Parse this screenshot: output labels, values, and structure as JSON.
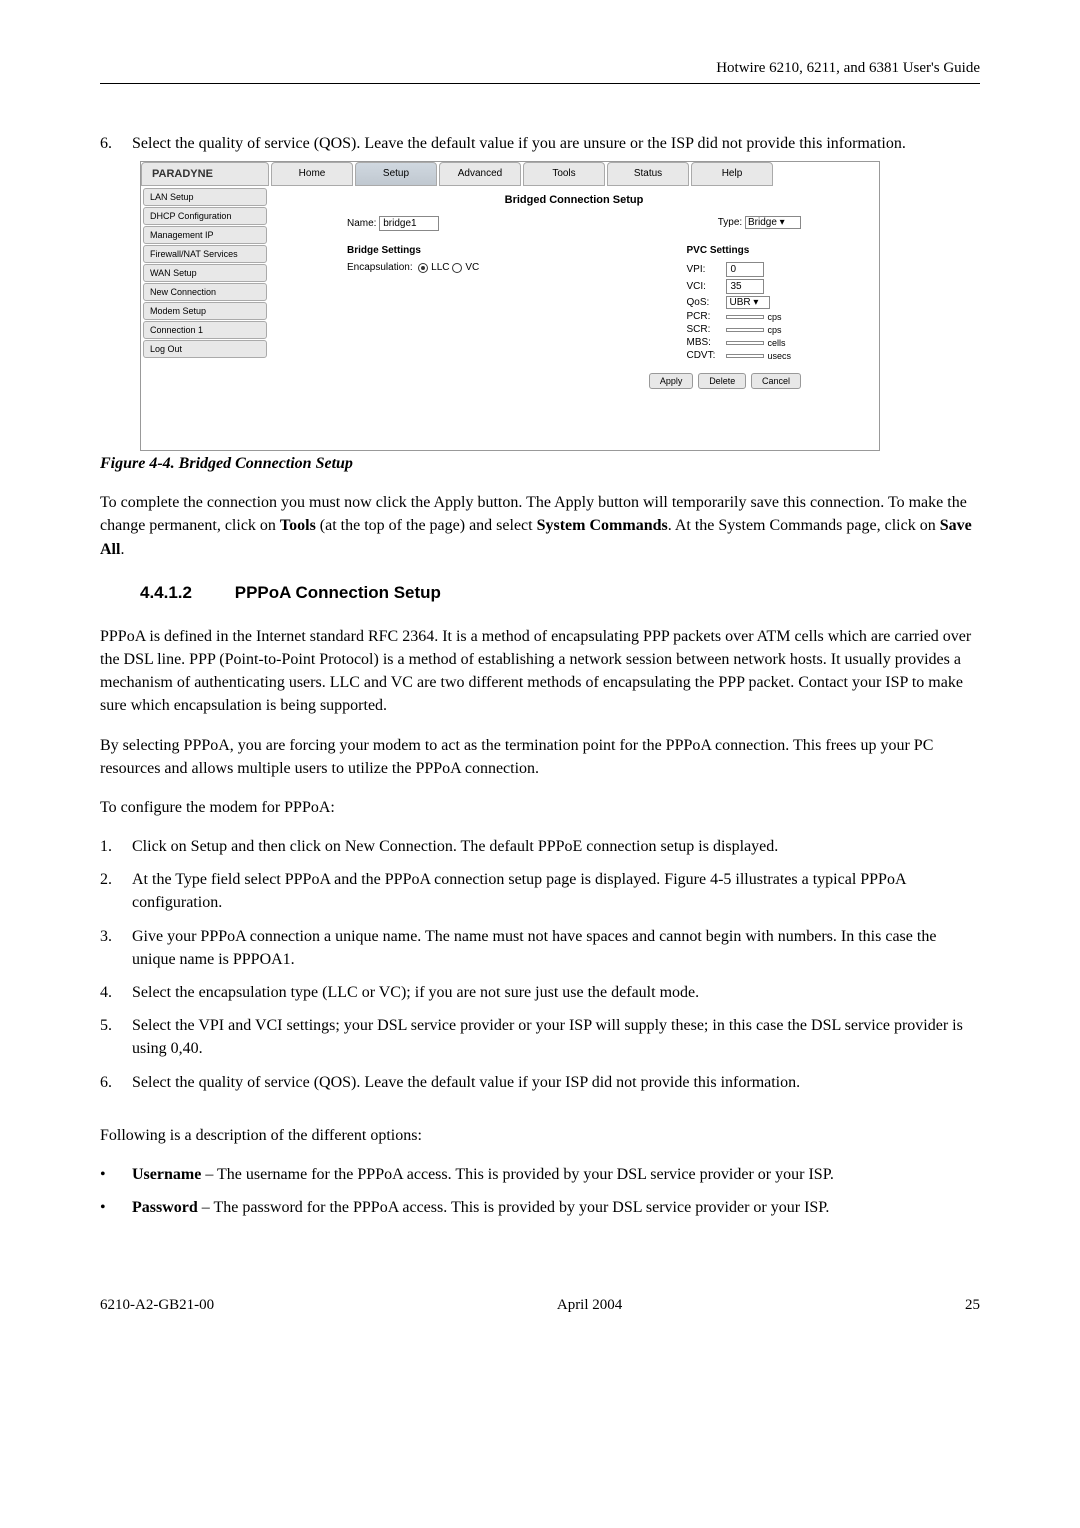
{
  "header": {
    "doc_title": "Hotwire 6210, 6211, and 6381 User's Guide"
  },
  "step6": {
    "num": "6.",
    "text": "Select the quality of service (QOS). Leave the default value if you are unsure or the ISP did not provide this information."
  },
  "screenshot": {
    "logo": "PARADYNE",
    "tabs": [
      "Home",
      "Setup",
      "Advanced",
      "Tools",
      "Status",
      "Help"
    ],
    "sidebar": [
      "LAN Setup",
      "DHCP Configuration",
      "Management IP",
      "Firewall/NAT Services",
      "WAN Setup",
      "New Connection",
      "Modem Setup",
      "Connection 1",
      "Log Out"
    ],
    "title": "Bridged Connection Setup",
    "name_label": "Name:",
    "name_value": "bridge1",
    "type_label": "Type:",
    "type_value": "Bridge",
    "bridge_settings": "Bridge Settings",
    "encap_label": "Encapsulation:",
    "encap_llc": "LLC",
    "encap_vc": "VC",
    "pvc_settings": "PVC Settings",
    "vpi_label": "VPI:",
    "vpi_value": "0",
    "vci_label": "VCI:",
    "vci_value": "35",
    "qos_label": "QoS:",
    "qos_value": "UBR",
    "pcr_label": "PCR:",
    "pcr_unit": "cps",
    "scr_label": "SCR:",
    "scr_unit": "cps",
    "mbs_label": "MBS:",
    "mbs_unit": "cells",
    "cdvt_label": "CDVT:",
    "cdvt_unit": "usecs",
    "buttons": [
      "Apply",
      "Delete",
      "Cancel"
    ]
  },
  "figure_caption": "Figure 4-4. Bridged Connection Setup",
  "para1_a": "To complete the connection you must now click the Apply button. The Apply button will temporarily save this connection. To make the change permanent, click on ",
  "para1_tools": "Tools",
  "para1_b": " (at the top of the page) and select ",
  "para1_sys": "System Commands",
  "para1_c": ". At the System Commands page, click on ",
  "para1_save": "Save All",
  "para1_d": ".",
  "section": {
    "num": "4.4.1.2",
    "title": "PPPoA Connection Setup"
  },
  "para2": "PPPoA is defined in the Internet standard RFC 2364. It is a method of encapsulating PPP packets over ATM cells which are carried over the DSL line. PPP (Point-to-Point Protocol) is a method of establishing a network session between network hosts. It usually provides a mechanism of authenticating users. LLC and VC are two different methods of encapsulating the PPP packet. Contact your ISP to make sure which encapsulation is being supported.",
  "para3": "By selecting PPPoA, you are forcing your modem to act as the termination point for the PPPoA connection. This frees up your PC resources and allows multiple users to utilize the PPPoA connection.",
  "para4": "To configure the modem for PPPoA:",
  "ol": [
    {
      "num": "1.",
      "text": "Click on Setup and then click on New Connection. The default PPPoE connection setup is displayed."
    },
    {
      "num": "2.",
      "text": "At the Type field select PPPoA and the PPPoA connection setup page is displayed. Figure 4-5 illustrates a typical PPPoA configuration."
    },
    {
      "num": "3.",
      "text": "Give your PPPoA connection a unique name. The name must not have spaces and cannot begin with numbers. In this case the unique name is PPPOA1."
    },
    {
      "num": "4.",
      "text": "Select the encapsulation type (LLC or VC); if you are not sure just use the default mode."
    },
    {
      "num": "5.",
      "text": "Select the VPI and VCI settings; your DSL service provider or your ISP will supply these; in this case the DSL service provider is using 0,40."
    },
    {
      "num": "6.",
      "text": "Select the quality of service (QOS). Leave the default value if your ISP did not provide this information."
    }
  ],
  "para5": "Following is a description of the different options:",
  "ul": [
    {
      "bold": "Username",
      "rest": " – The username for the PPPoA access. This is provided by your DSL service provider or your ISP."
    },
    {
      "bold": "Password",
      "rest": " – The password for the PPPoA access. This is provided by your DSL service provider or your ISP."
    }
  ],
  "footer": {
    "left": "6210-A2-GB21-00",
    "center": "April 2004",
    "right": "25"
  }
}
